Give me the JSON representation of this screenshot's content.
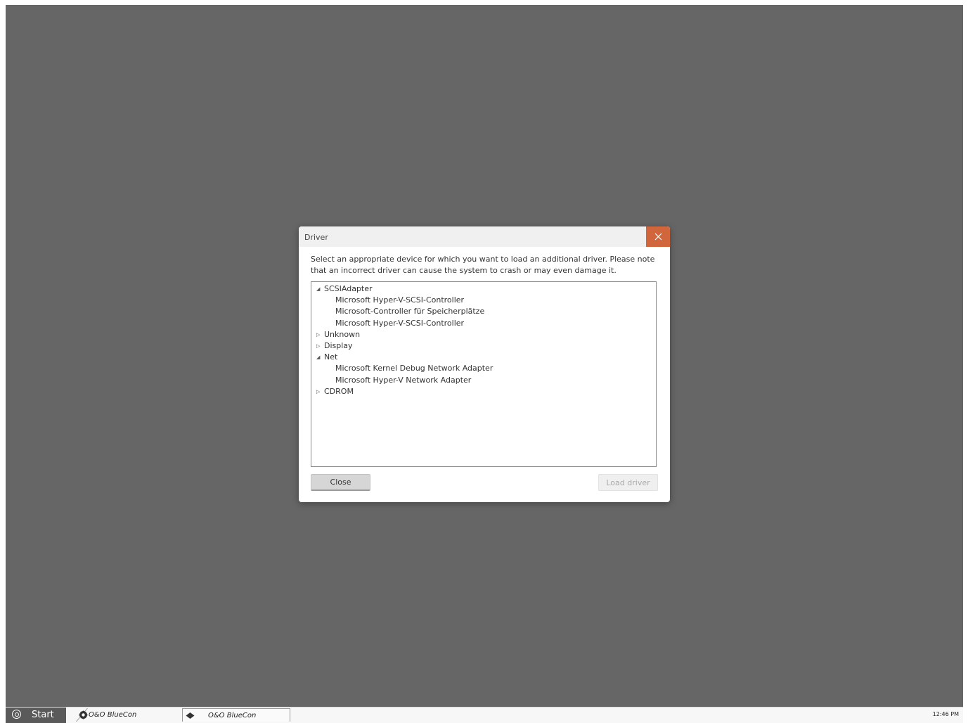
{
  "dialog": {
    "title": "Driver",
    "description": "Select an appropriate device for which you want to load an additional driver. Please note that an incorrect driver can cause the system to crash or may even damage it.",
    "tree": [
      {
        "label": "SCSIAdapter",
        "level": 0,
        "expanded": true
      },
      {
        "label": "Microsoft Hyper-V-SCSI-Controller",
        "level": 1
      },
      {
        "label": "Microsoft-Controller für Speicherplätze",
        "level": 1
      },
      {
        "label": "Microsoft Hyper-V-SCSI-Controller",
        "level": 1
      },
      {
        "label": "Unknown",
        "level": 0,
        "expanded": false
      },
      {
        "label": "Display",
        "level": 0,
        "expanded": false
      },
      {
        "label": "Net",
        "level": 0,
        "expanded": true
      },
      {
        "label": "Microsoft Kernel Debug Network Adapter",
        "level": 1
      },
      {
        "label": "Microsoft Hyper-V Network Adapter",
        "level": 1
      },
      {
        "label": "CDROM",
        "level": 0,
        "expanded": false
      }
    ],
    "close_label": "Close",
    "load_label": "Load driver",
    "accent_color": "#d1663c"
  },
  "taskbar": {
    "start_label": "Start",
    "tasks": [
      {
        "label": "O&O BlueCon",
        "icon": "bluecon-gear-icon"
      },
      {
        "label": "O&O BlueCon",
        "icon": "bluecon-diamond-icon"
      }
    ],
    "clock": "12:46 PM"
  }
}
